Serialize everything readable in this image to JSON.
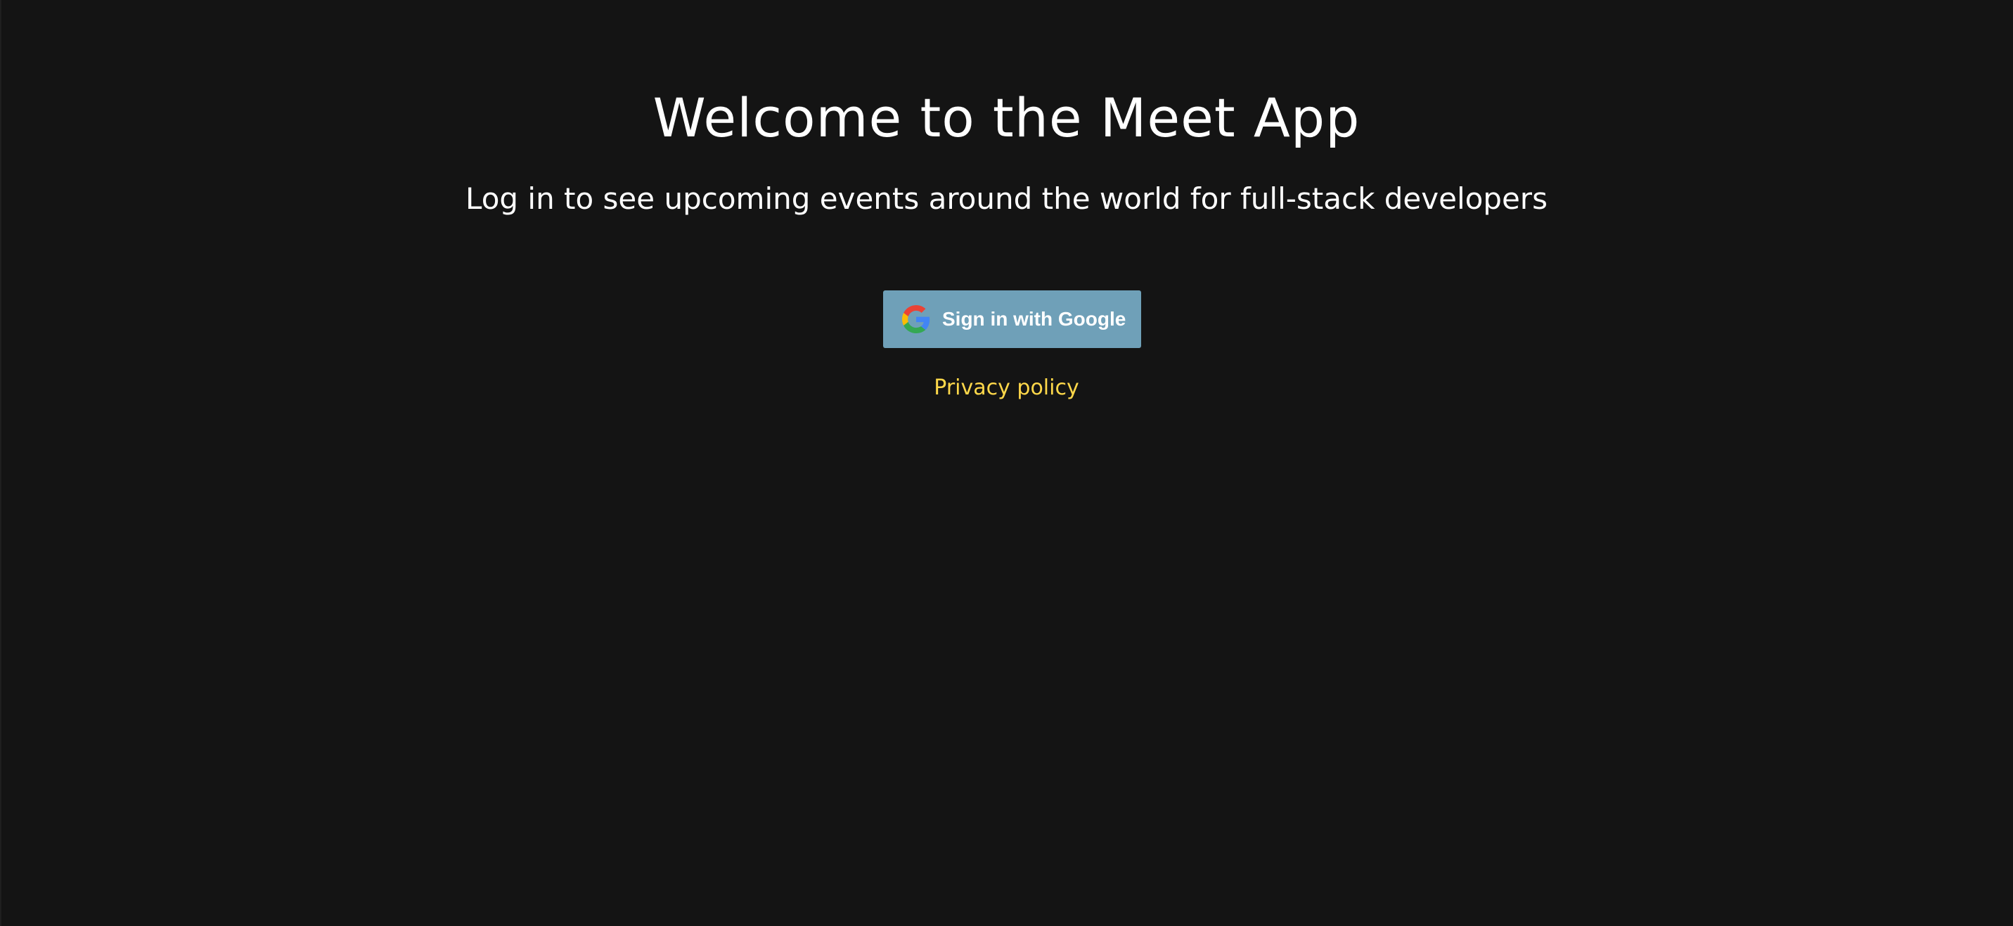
{
  "header": {
    "title": "Welcome to the Meet App",
    "subtitle": "Log in to see upcoming events around the world for full-stack developers"
  },
  "auth": {
    "google_button_label": "Sign in with Google",
    "google_icon": "google-logo-icon"
  },
  "footer": {
    "privacy_link_label": "Privacy policy"
  },
  "colors": {
    "background": "#141414",
    "button": "#6fa0b8",
    "link": "#ffd84a",
    "text": "#ffffff"
  }
}
